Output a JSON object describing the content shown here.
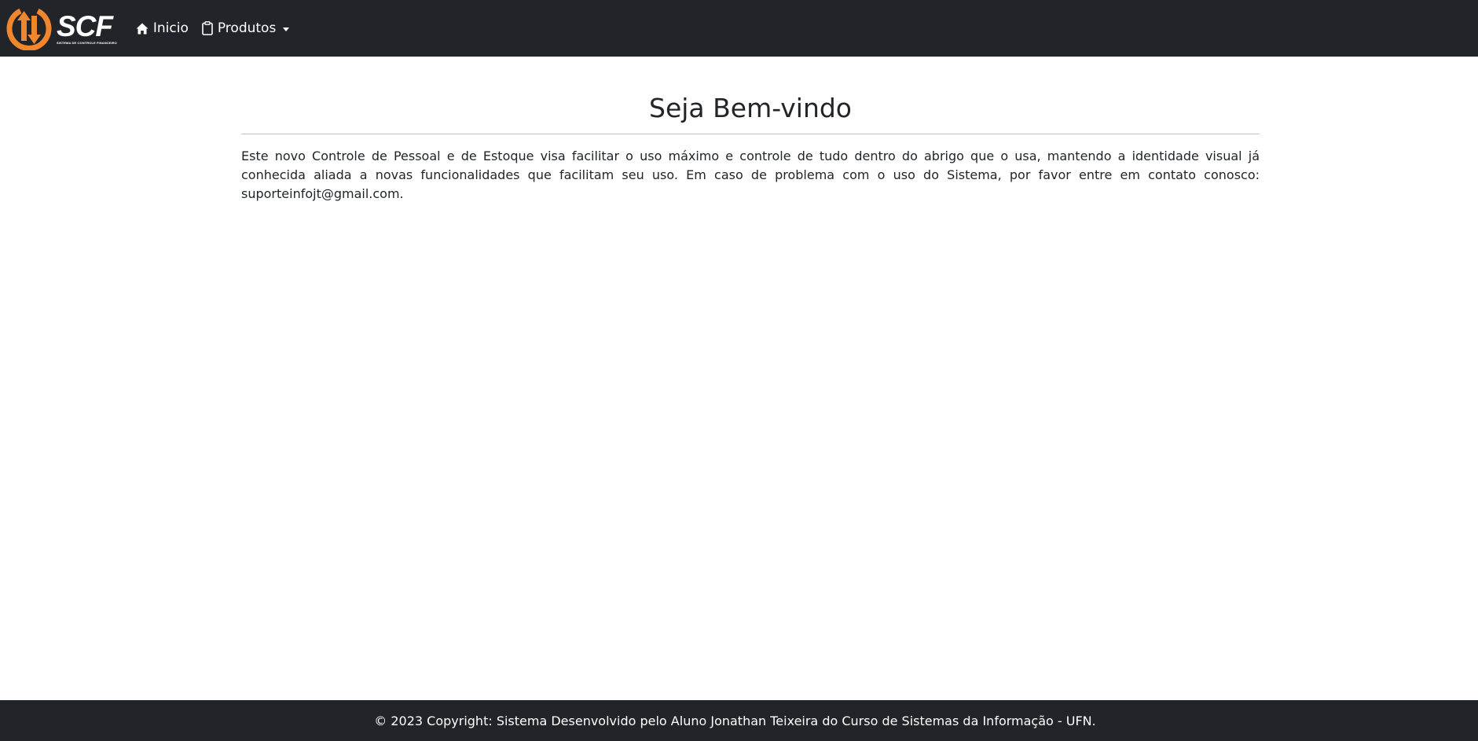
{
  "navbar": {
    "brand": {
      "name": "SCF",
      "subtitle": "SISTEMA DE CONTROLE FINANCEIRO",
      "icon": "scf-logo-icon",
      "accent_color": "#F0862E"
    },
    "items": [
      {
        "label": "Inicio",
        "icon": "home-icon"
      },
      {
        "label": "Produtos",
        "icon": "clipboard-icon",
        "dropdown": true
      }
    ],
    "background": "#212529"
  },
  "main": {
    "title": "Seja Bem-vindo",
    "intro": "Este novo Controle de Pessoal e de Estoque visa facilitar o uso máximo e controle de tudo dentro do abrigo que o usa, mantendo a identidade visual já conhecida aliada a novas funcionalidades que facilitam seu uso. Em caso de problema com o uso do Sistema, por favor entre em contato conosco: suporteinfojt@gmail.com."
  },
  "footer": {
    "text": "© 2023 Copyright: Sistema Desenvolvido pelo Aluno Jonathan Teixeira do Curso de Sistemas da Informação - UFN."
  }
}
